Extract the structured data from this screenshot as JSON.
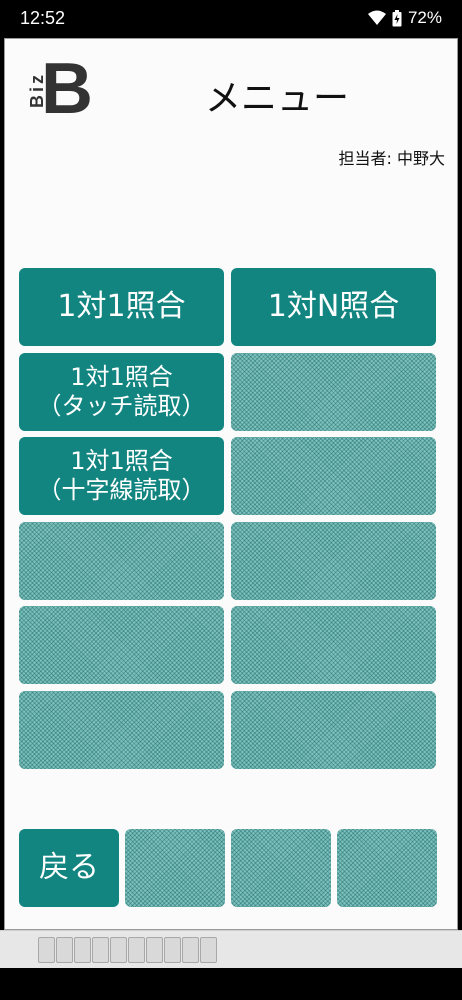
{
  "status": {
    "time": "12:52",
    "battery": "72%"
  },
  "app": {
    "logo": {
      "small": "Biz",
      "big": "B"
    },
    "title": "メニュー",
    "operator": "担当者: 中野大"
  },
  "buttons": {
    "one_to_one": "1対1照合",
    "one_to_n": "1対N照合",
    "one_to_one_touch": "1対1照合\n（タッチ読取）",
    "one_to_one_cross": "1対1照合\n（十字線読取）",
    "back": "戻る"
  },
  "colors": {
    "accent": "#128580",
    "disabled": "#7fbfbc"
  }
}
